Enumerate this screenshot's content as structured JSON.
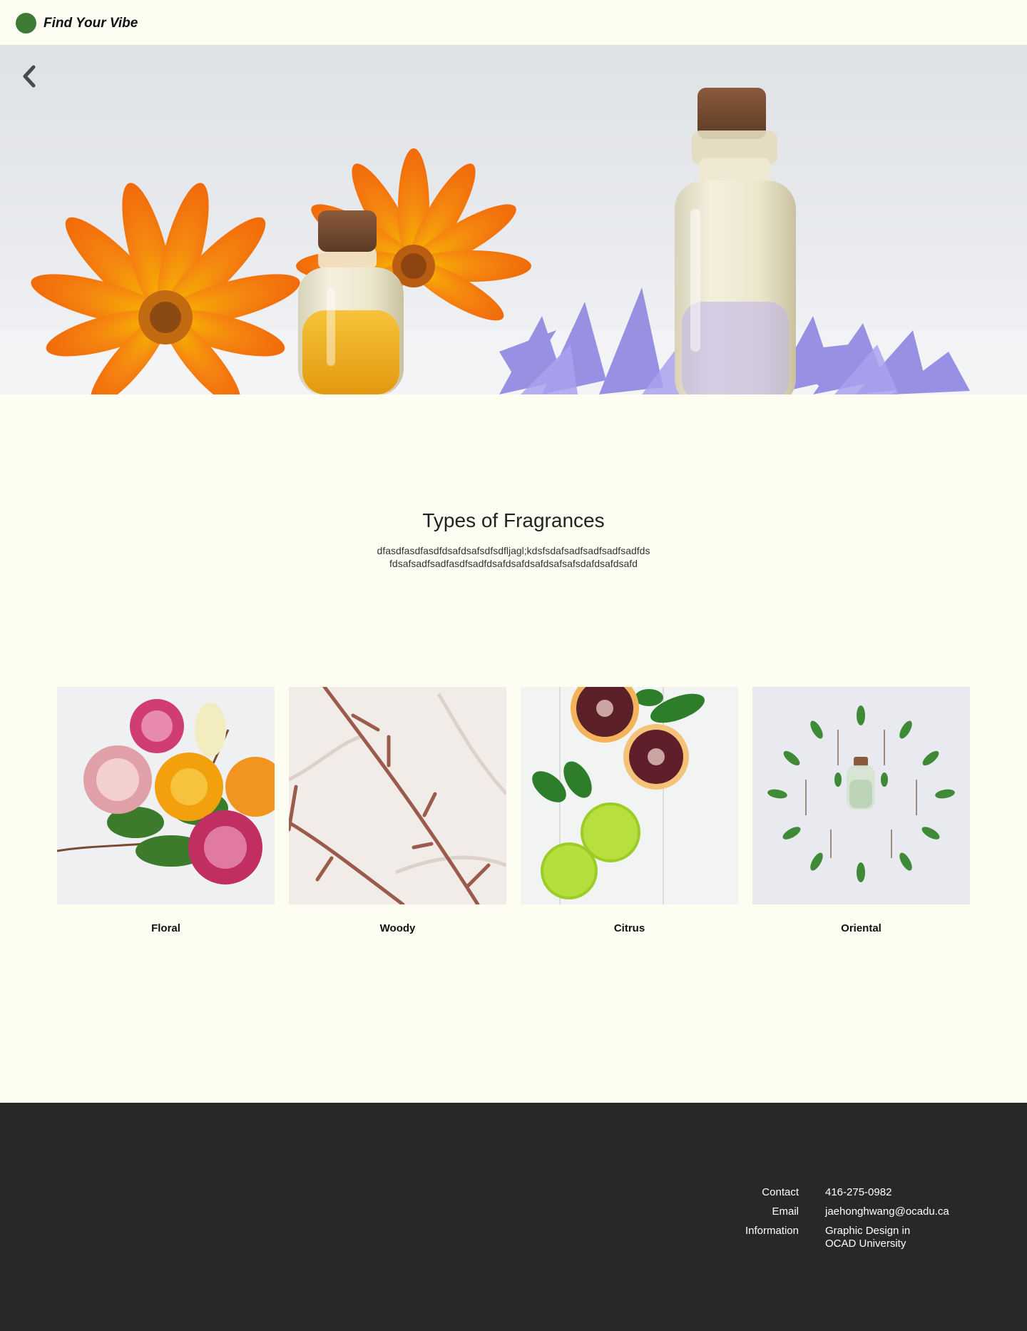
{
  "header": {
    "brand": "Find Your Vibe",
    "logo_color": "#3e7b37"
  },
  "hero": {
    "back_icon": "chevron-left-icon"
  },
  "section": {
    "title": "Types of Fragrances",
    "description_line1": "dfasdfasdfasdfdsafdsafsdfsdfljagl;kdsfsdafsadfsadfsadfsadfds",
    "description_line2": "fdsafsadfsadfasdfsadfdsafdsafdsafdsafsafsdafdsafdsafd"
  },
  "cards": [
    {
      "label": "Floral"
    },
    {
      "label": "Woody"
    },
    {
      "label": "Citrus"
    },
    {
      "label": "Oriental"
    }
  ],
  "footer": {
    "contact_label": "Contact",
    "contact_value": "416-275-0982",
    "email_label": "Email",
    "email_value": "jaehonghwang@ocadu.ca",
    "info_label": "Information",
    "info_line1": "Graphic Design in",
    "info_line2": "OCAD University"
  },
  "colors": {
    "page_bg": "#fdfdf2",
    "footer_bg": "#282828"
  }
}
